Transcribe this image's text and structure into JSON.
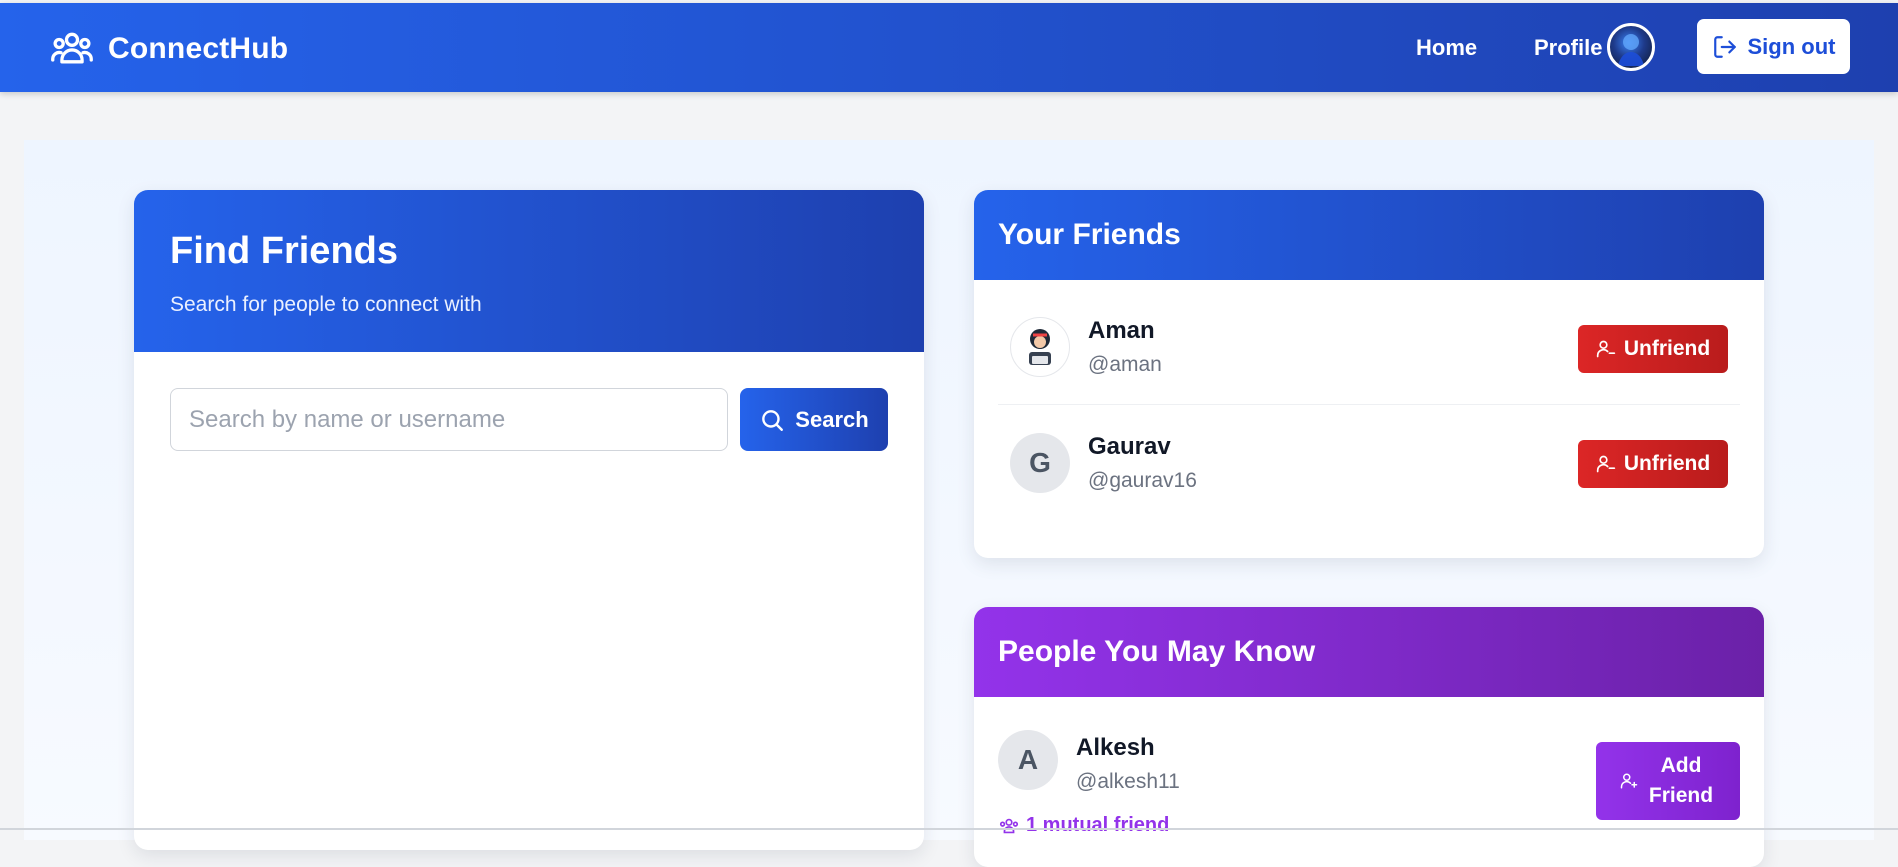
{
  "nav": {
    "brand": "ConnectHub",
    "home": "Home",
    "profile": "Profile",
    "signout": "Sign out"
  },
  "find": {
    "title": "Find Friends",
    "subtitle": "Search for people to connect with",
    "search_placeholder": "Search by name or username",
    "search_button": "Search"
  },
  "friends": {
    "title": "Your Friends",
    "items": [
      {
        "name": "Aman",
        "username": "@aman",
        "initial": "",
        "action": "Unfriend"
      },
      {
        "name": "Gaurav",
        "username": "@gaurav16",
        "initial": "G",
        "action": "Unfriend"
      }
    ]
  },
  "people": {
    "title": "People You May Know",
    "items": [
      {
        "name": "Alkesh",
        "username": "@alkesh11",
        "initial": "A",
        "mutual": "1 mutual friend",
        "action": "Add Friend"
      }
    ]
  },
  "colors": {
    "primary": "#2563eb",
    "primary_dark": "#1e40af",
    "danger": "#dc2626",
    "purple": "#9333ea"
  }
}
